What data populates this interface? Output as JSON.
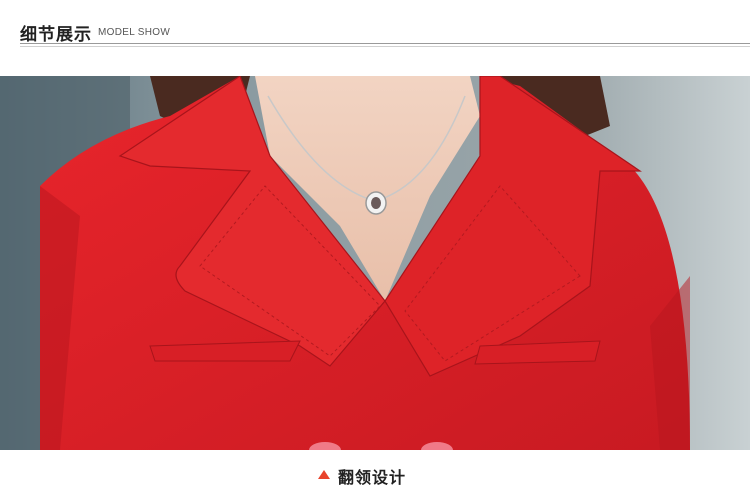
{
  "header": {
    "title_cn": "细节展示",
    "title_en": "MODEL SHOW"
  },
  "photo": {
    "description_icon": "product-detail-photo",
    "accent_color": "#e0242a"
  },
  "caption": {
    "icon": "triangle-up-icon",
    "text": "翻领设计",
    "icon_color": "#e8432c"
  }
}
